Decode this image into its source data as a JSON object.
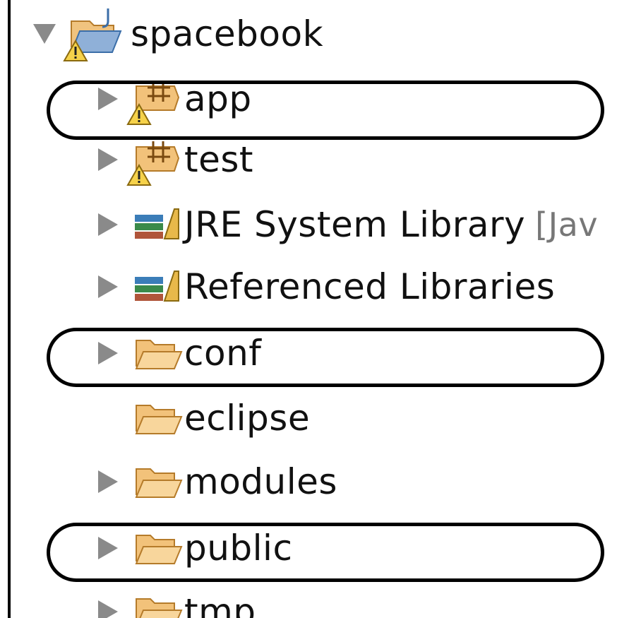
{
  "tree": {
    "root": {
      "label": "spacebook",
      "icon": "project-warning-icon"
    },
    "items": [
      {
        "label": "app",
        "icon": "source-package-warning-icon",
        "expandable": true,
        "highlighted": true
      },
      {
        "label": "test",
        "icon": "source-package-warning-icon",
        "expandable": true,
        "highlighted": false
      },
      {
        "label": "JRE System Library",
        "suffix": "[Jav",
        "icon": "library-icon",
        "expandable": true,
        "highlighted": false
      },
      {
        "label": "Referenced Libraries",
        "icon": "library-icon",
        "expandable": true,
        "highlighted": false
      },
      {
        "label": "conf",
        "icon": "folder-icon",
        "expandable": true,
        "highlighted": true
      },
      {
        "label": "eclipse",
        "icon": "folder-icon",
        "expandable": false,
        "highlighted": false
      },
      {
        "label": "modules",
        "icon": "folder-icon",
        "expandable": true,
        "highlighted": false
      },
      {
        "label": "public",
        "icon": "folder-icon",
        "expandable": true,
        "highlighted": true
      },
      {
        "label": "tmp",
        "icon": "folder-icon",
        "expandable": true,
        "highlighted": false
      }
    ]
  },
  "colors": {
    "folder": "#f2c27a",
    "folder_stroke": "#b57b2a",
    "twisty": "#8a8a8a",
    "highlight_border": "#000000"
  }
}
